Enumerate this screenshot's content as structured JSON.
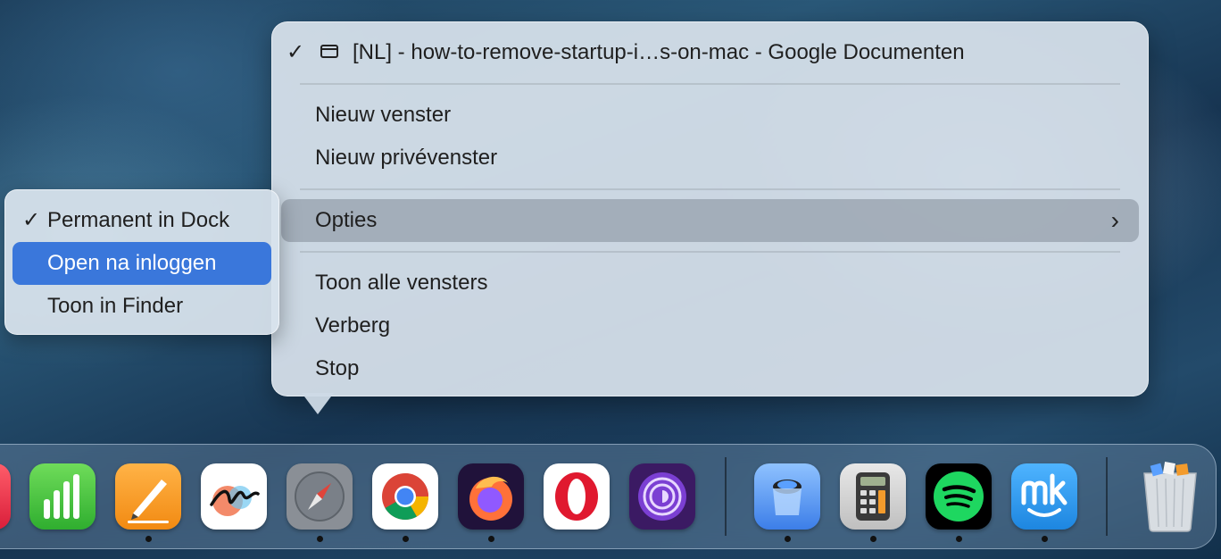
{
  "context_menu": {
    "window_item": "[NL] - how-to-remove-startup-i…s-on-mac - Google Documenten",
    "window_checked": true,
    "new_window": "Nieuw venster",
    "new_private_window": "Nieuw privévenster",
    "options": "Opties",
    "show_all_windows": "Toon alle vensters",
    "hide": "Verberg",
    "quit": "Stop"
  },
  "options_submenu": {
    "keep_in_dock": "Permanent in Dock",
    "keep_in_dock_checked": true,
    "open_at_login": "Open na inloggen",
    "show_in_finder": "Toon in Finder"
  },
  "dock": {
    "apps": [
      {
        "name": "numbers-icon",
        "running": false
      },
      {
        "name": "pages-icon",
        "running": true
      },
      {
        "name": "freeform-icon",
        "running": false
      },
      {
        "name": "safari-icon",
        "running": true
      },
      {
        "name": "chrome-icon",
        "running": true
      },
      {
        "name": "firefox-icon",
        "running": true
      },
      {
        "name": "opera-icon",
        "running": false
      },
      {
        "name": "tor-browser-icon",
        "running": false
      },
      {
        "name": "preview-icon",
        "running": true
      },
      {
        "name": "calculator-icon",
        "running": true
      },
      {
        "name": "spotify-icon",
        "running": true
      },
      {
        "name": "mackeeper-icon",
        "running": true
      },
      {
        "name": "trash-icon",
        "running": false
      }
    ],
    "accent": "#3a77db"
  }
}
